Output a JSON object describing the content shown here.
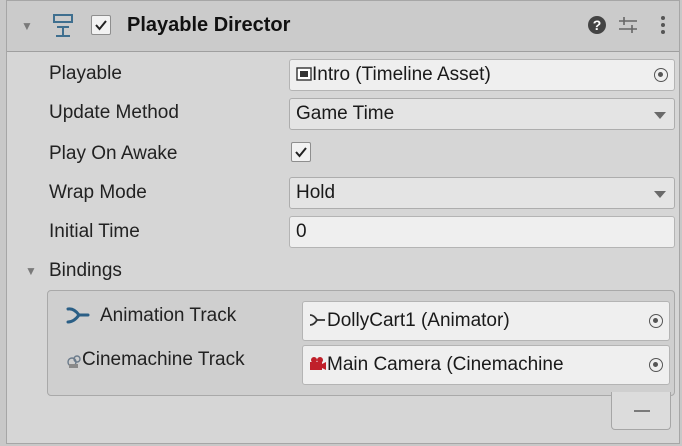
{
  "component": {
    "title": "Playable Director",
    "enabled": true,
    "icons": [
      "help-icon",
      "preset-icon",
      "more-icon"
    ]
  },
  "properties": {
    "playable": {
      "label": "Playable",
      "value": "Intro (Timeline Asset)"
    },
    "update_method": {
      "label": "Update Method",
      "value": "Game Time"
    },
    "play_on_awake": {
      "label": "Play On Awake",
      "checked": true
    },
    "wrap_mode": {
      "label": "Wrap Mode",
      "value": "Hold"
    },
    "initial_time": {
      "label": "Initial Time",
      "value": "0"
    }
  },
  "bindings": {
    "label": "Bindings",
    "items": [
      {
        "label": "Animation Track",
        "value": "DollyCart1 (Animator)"
      },
      {
        "label": "Cinemachine Track",
        "value": "Main Camera (Cinemachine"
      }
    ]
  },
  "colors": {
    "panel_bg": "#d6d6d6",
    "field_bg": "#efefef"
  }
}
